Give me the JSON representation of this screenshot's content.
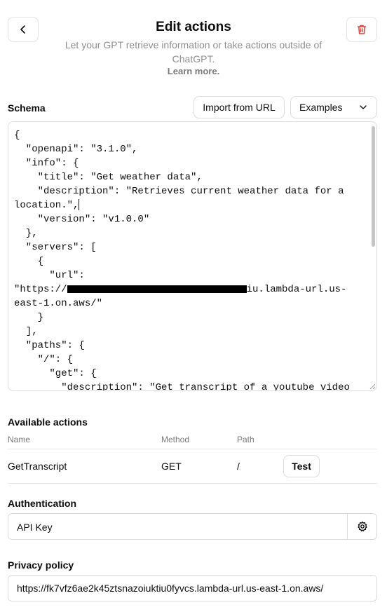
{
  "header": {
    "title": "Edit actions",
    "subtitle": "Let your GPT retrieve information or take actions outside of ChatGPT.",
    "learn_more": "Learn more."
  },
  "schema": {
    "label": "Schema",
    "import_label": "Import from URL",
    "examples_label": "Examples",
    "lines": [
      "{",
      "  \"openapi\": \"3.1.0\",",
      "  \"info\": {",
      "    \"title\": \"Get weather data\",",
      "    \"description\": \"Retrieves current weather data for a",
      "location.\",",
      "    \"version\": \"v1.0.0\"",
      "  },",
      "  \"servers\": [",
      "    {",
      "      \"url\":",
      "\"https://",
      "iu.lambda-url.us-",
      "east-1.on.aws/\"",
      "    }",
      "  ],",
      "  \"paths\": {",
      "    \"/\": {",
      "      \"get\": {",
      "        \"description\": \"Get transcript of a youtube video"
    ]
  },
  "actions": {
    "label": "Available actions",
    "columns": [
      "Name",
      "Method",
      "Path"
    ],
    "rows": [
      {
        "name": "GetTranscript",
        "method": "GET",
        "path": "/",
        "test_label": "Test"
      }
    ]
  },
  "authentication": {
    "label": "Authentication",
    "value": "API Key"
  },
  "privacy": {
    "label": "Privacy policy",
    "value": "https://fk7vfz6ae2k45ztsnazoiuktiu0fyvcs.lambda-url.us-east-1.on.aws/"
  },
  "icons": {
    "back": "chevron-left-icon",
    "delete": "trash-icon",
    "dropdown": "chevron-down-icon",
    "settings": "gear-icon"
  },
  "colors": {
    "delete_accent": "#e0403a",
    "border": "#dcdcdc",
    "muted_text": "#8f8f8f"
  }
}
